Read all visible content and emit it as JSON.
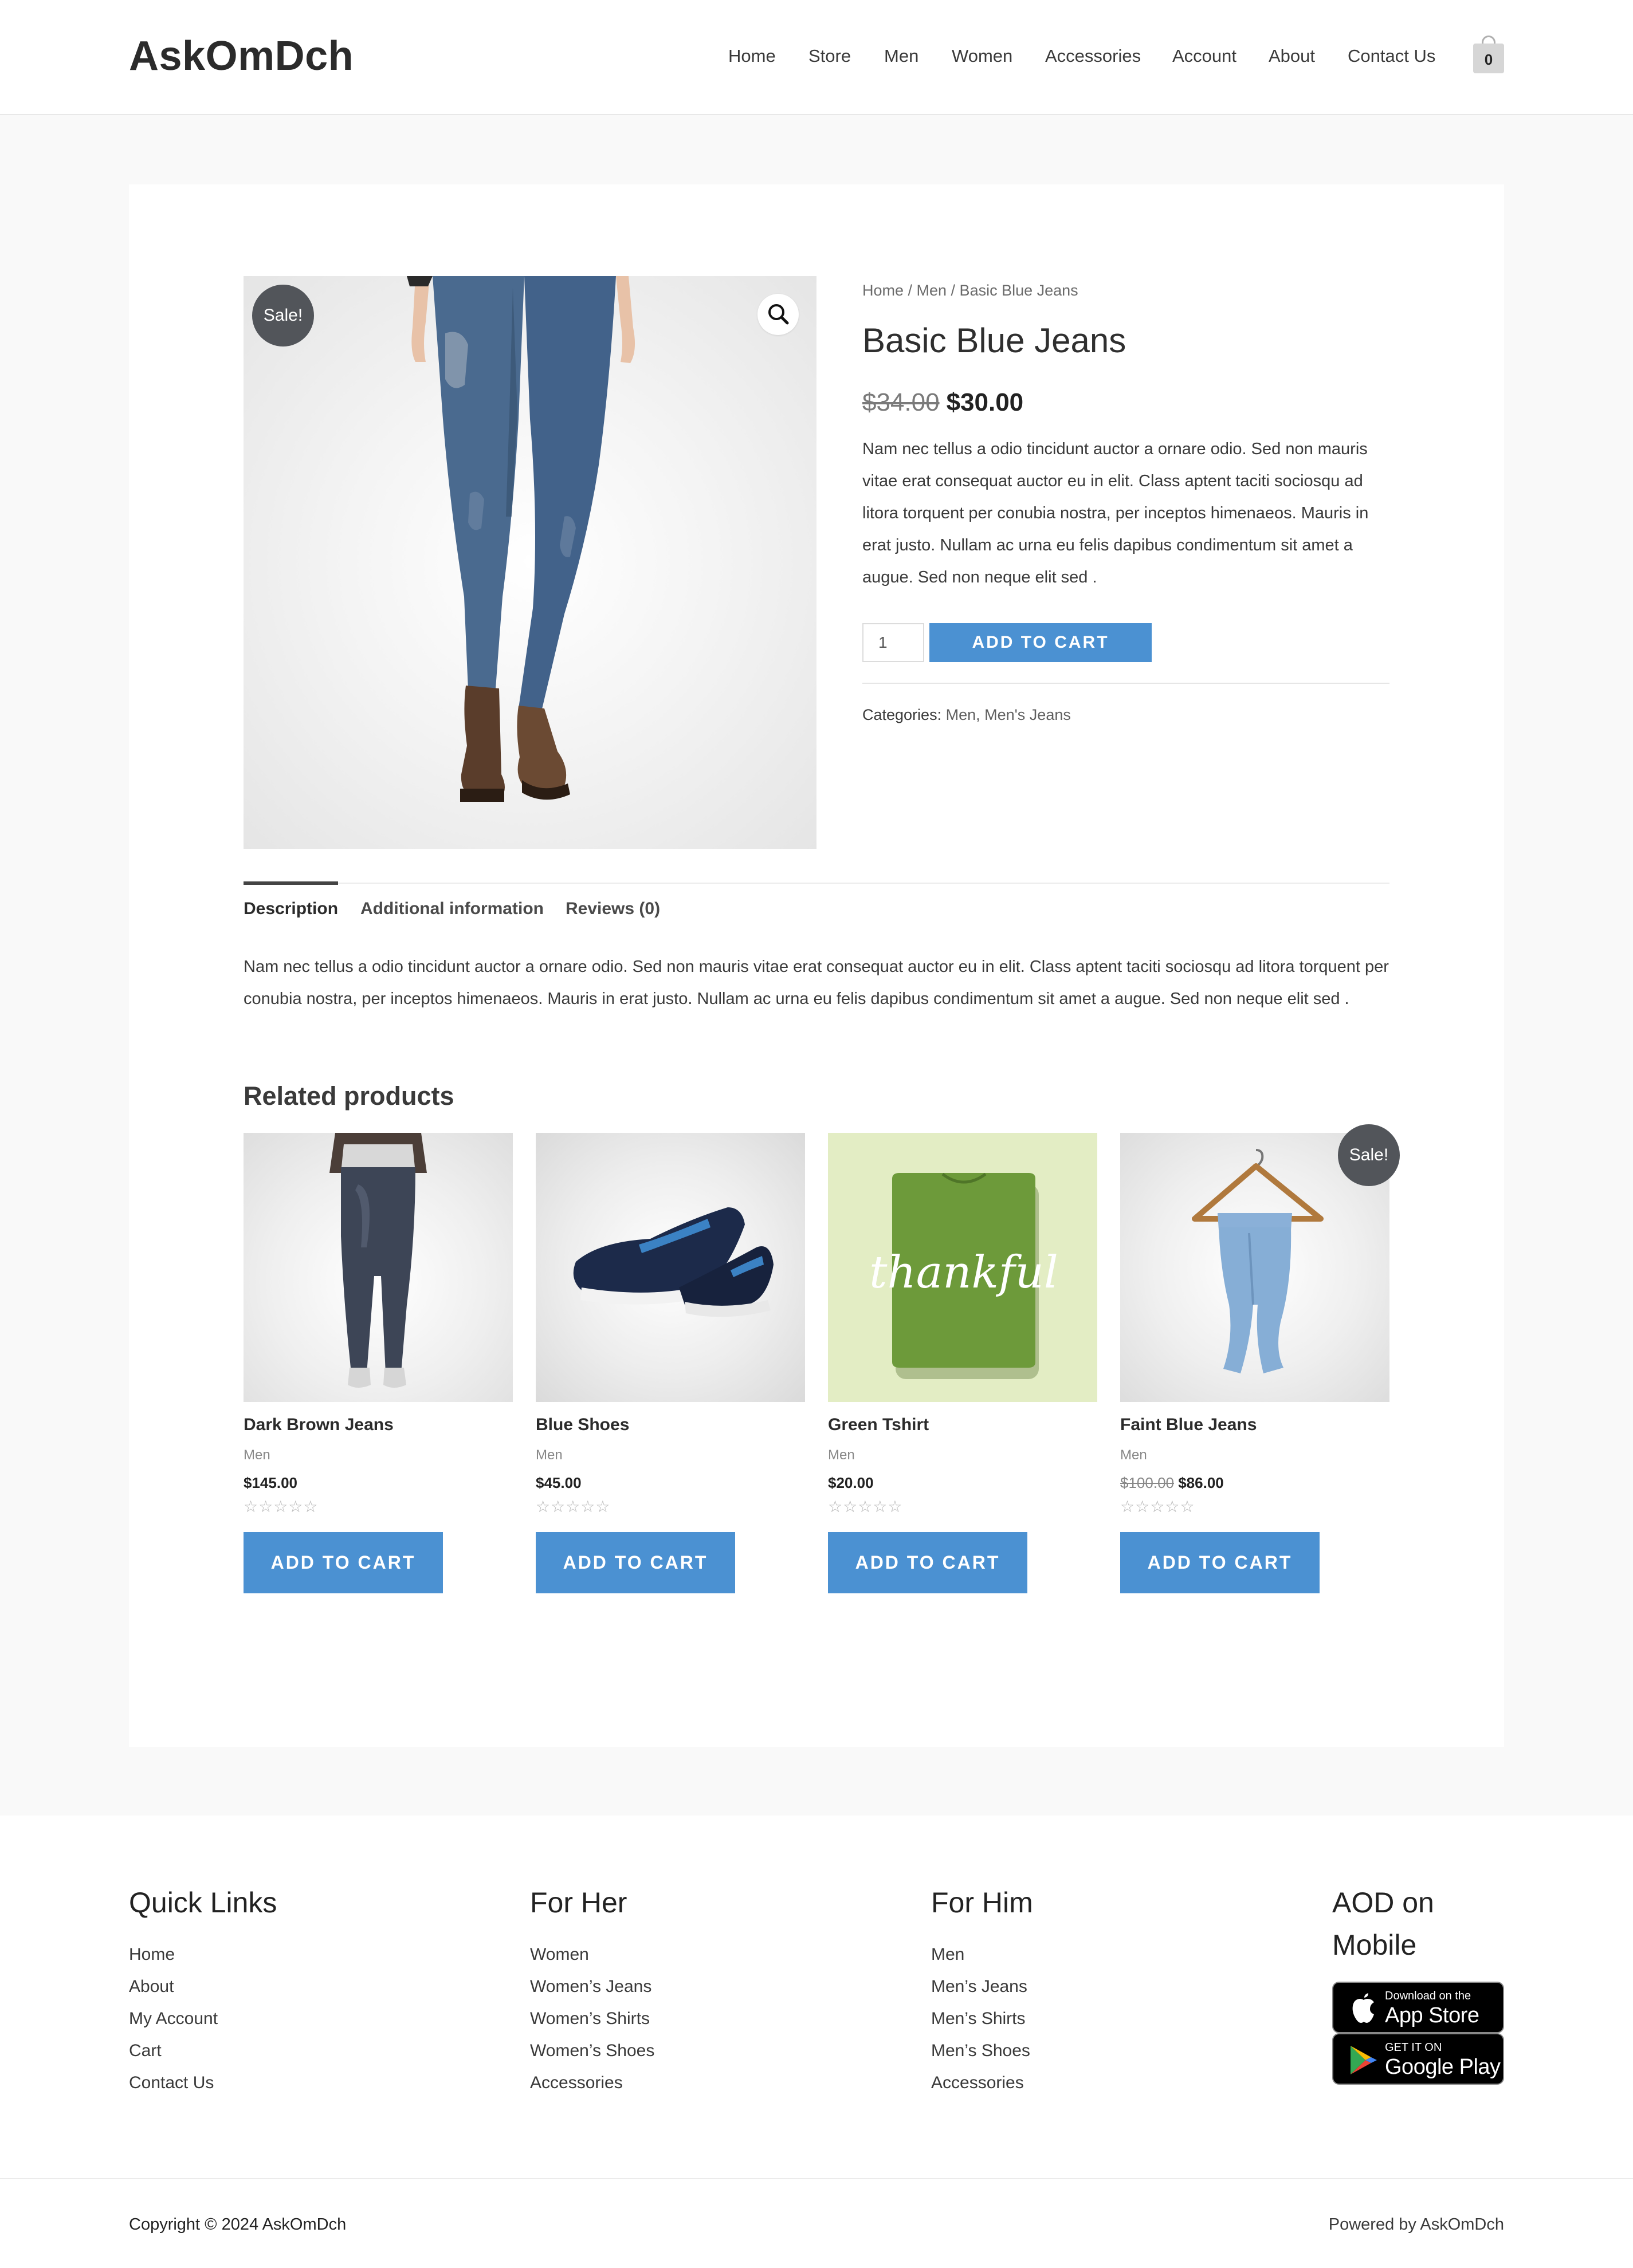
{
  "header": {
    "logo": "AskOmDch",
    "nav": [
      "Home",
      "Store",
      "Men",
      "Women",
      "Accessories",
      "Account",
      "About",
      "Contact Us"
    ],
    "cart_count": "0"
  },
  "product": {
    "sale_badge": "Sale!",
    "breadcrumb": "Home / Men / Basic Blue Jeans",
    "title": "Basic Blue Jeans",
    "old_price": "$34.00",
    "price": "$30.00",
    "short_description": "Nam nec tellus a odio tincidunt auctor a ornare odio. Sed non mauris vitae erat consequat auctor eu in elit. Class aptent taciti sociosqu ad litora torquent per conubia nostra, per inceptos himenaeos. Mauris in erat justo. Nullam ac urna eu felis dapibus condimentum sit amet a augue. Sed non neque elit sed .",
    "quantity": "1",
    "add_to_cart": "ADD TO CART",
    "categories_label": "Categories:",
    "categories": "Men, Men's Jeans"
  },
  "tabs": {
    "items": [
      "Description",
      "Additional information",
      "Reviews (0)"
    ],
    "description": "Nam nec tellus a odio tincidunt auctor a ornare odio. Sed non mauris vitae erat consequat auctor eu in elit. Class aptent taciti sociosqu ad litora torquent per conubia nostra, per inceptos himenaeos. Mauris in erat justo. Nullam ac urna eu felis dapibus condimentum sit amet a augue. Sed non neque elit sed ."
  },
  "related": {
    "title": "Related products",
    "items": [
      {
        "name": "Dark Brown Jeans",
        "category": "Men",
        "old_price": "",
        "price": "$145.00",
        "stars": "☆☆☆☆☆",
        "button": "ADD TO CART",
        "sale": ""
      },
      {
        "name": "Blue Shoes",
        "category": "Men",
        "old_price": "",
        "price": "$45.00",
        "stars": "☆☆☆☆☆",
        "button": "ADD TO CART",
        "sale": ""
      },
      {
        "name": "Green Tshirt",
        "category": "Men",
        "old_price": "",
        "price": "$20.00",
        "stars": "☆☆☆☆☆",
        "button": "ADD TO CART",
        "sale": ""
      },
      {
        "name": "Faint Blue Jeans",
        "category": "Men",
        "old_price": "$100.00",
        "price": "$86.00",
        "stars": "☆☆☆☆☆",
        "button": "ADD TO CART",
        "sale": "Sale!"
      }
    ],
    "tshirt_text": "thankful"
  },
  "footer": {
    "quick_links": {
      "title": "Quick Links",
      "links": [
        "Home",
        "About",
        "My Account",
        "Cart",
        "Contact Us"
      ]
    },
    "for_her": {
      "title": "For Her",
      "links": [
        "Women",
        "Women’s Jeans",
        "Women’s Shirts",
        "Women’s Shoes",
        "Accessories"
      ]
    },
    "for_him": {
      "title": "For Him",
      "links": [
        "Men",
        "Men’s Jeans",
        "Men’s Shirts",
        "Men’s Shoes",
        "Accessories"
      ]
    },
    "mobile": {
      "title_line1": "AOD on",
      "title_line2": "Mobile",
      "app_store_small": "Download on the",
      "app_store_big": "App Store",
      "google_small": "GET IT ON",
      "google_big": "Google Play"
    },
    "copyright": "Copyright © 2024 AskOmDch",
    "powered": "Powered by AskOmDch"
  },
  "colors": {
    "accent": "#4b91d2",
    "badge": "#52555a",
    "page_bg": "#f9f9f9"
  }
}
